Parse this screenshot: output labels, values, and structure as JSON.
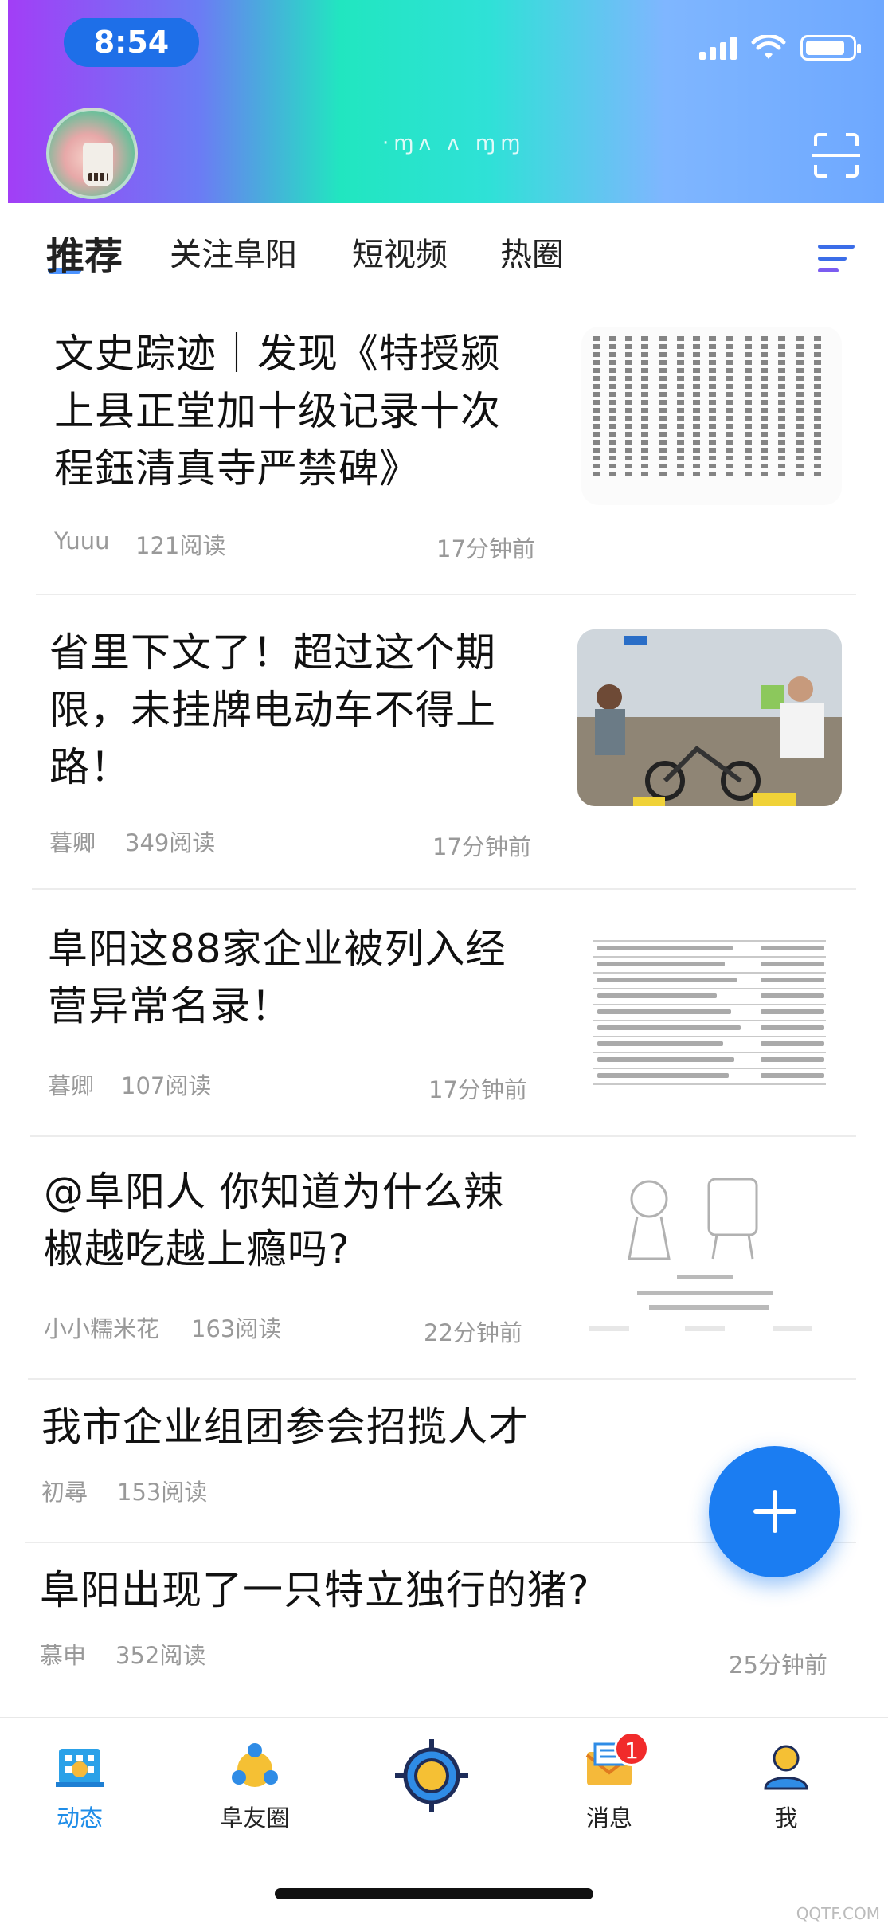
{
  "status_bar": {
    "time": "8:54"
  },
  "header": {
    "user_name": "·ɱʌ ʌ ɱɱ"
  },
  "tabs": [
    {
      "label": "推荐",
      "active": true
    },
    {
      "label": "关注阜阳",
      "active": false
    },
    {
      "label": "短视频",
      "active": false
    },
    {
      "label": "热圈",
      "active": false
    }
  ],
  "feed": [
    {
      "title_lines": [
        "文史踪迹｜发现《特授颍",
        "上县正堂加十级记录十次",
        "程鈺清真寺严禁碑》"
      ],
      "author": "Yuuu",
      "reads": "121阅读",
      "time": "17分钟前",
      "thumb": "document-scan"
    },
    {
      "title_lines": [
        "省里下文了！超过这个期",
        "限，未挂牌电动车不得上",
        "路！"
      ],
      "author": "暮卿",
      "reads": "349阅读",
      "time": "17分钟前",
      "thumb": "photo-ebikes"
    },
    {
      "title_lines": [
        "阜阳这88家企业被列入经",
        "营异常名录！"
      ],
      "author": "暮卿",
      "reads": "107阅读",
      "time": "17分钟前",
      "thumb": "company-table"
    },
    {
      "title_lines": [
        "@阜阳人  你知道为什么辣",
        "椒越吃越上瘾吗?"
      ],
      "author": "小小糯米花",
      "reads": "163阅读",
      "time": "22分钟前",
      "thumb": "cartoon"
    },
    {
      "title_lines": [
        "我市企业组团参会招揽人才"
      ],
      "author": "初尋",
      "reads": "153阅读",
      "time": ""
    },
    {
      "title_lines": [
        "阜阳出现了一只特立独行的猪?"
      ],
      "author": "慕申",
      "reads": "352阅读",
      "time": "25分钟前"
    }
  ],
  "bottom_nav": [
    {
      "label": "动态",
      "icon": "map-building-icon",
      "active": true
    },
    {
      "label": "阜友圈",
      "icon": "friends-circle-icon",
      "active": false
    },
    {
      "label": "",
      "icon": "locate-center-icon",
      "active": false
    },
    {
      "label": "消息",
      "icon": "mail-icon",
      "active": false,
      "badge": "1"
    },
    {
      "label": "我",
      "icon": "person-icon",
      "active": false
    }
  ],
  "watermark": "QQTF.COM",
  "colors": {
    "accent": "#1b7df2",
    "active_nav": "#1f8de8",
    "badge": "#f12b2b"
  }
}
